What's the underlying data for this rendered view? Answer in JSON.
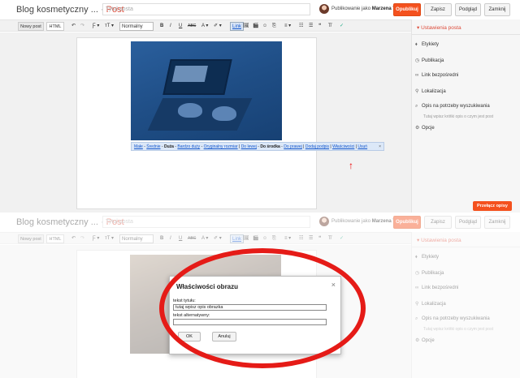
{
  "header": {
    "blog_title": "Blog kosmetyczny ...",
    "separator": "·",
    "section": "Post",
    "title_placeholder": "Tytuł posta",
    "publishing_as_prefix": "Publikowanie jako ",
    "user_name": "Marzena T",
    "publish_button": "Opublikuj",
    "save_button": "Zapisz",
    "preview_button": "Podgląd",
    "close_button": "Zamknij"
  },
  "toolbar": {
    "compose_mode": "Nowy post",
    "html_mode": "HTML",
    "undo": "↶",
    "redo": "↷",
    "font": "Ƒ ▾",
    "font_size": "ᴛT ▾",
    "format": "Normalny",
    "bold": "B",
    "italic": "I",
    "underline": "U",
    "strike": "ABC",
    "text_color": "A ▾",
    "highlight": "✐ ▾",
    "link": "Link",
    "image": "🖼",
    "video": "🎬",
    "emoji": "☺",
    "jump": "⎘",
    "align": "≡ ▾",
    "numbered": "☷",
    "bulleted": "☰",
    "quote": "❝",
    "clear": "T̸",
    "spell": "✓"
  },
  "image_size_bar": {
    "small": "Małe",
    "medium": "Średnie",
    "large": "Duża",
    "xlarge": "Bardzo duży",
    "original": "Oryginalny rozmiar",
    "left": "Do lewej",
    "center": "Do środka",
    "right": "Do prawej",
    "caption": "Dodaj podpis",
    "properties": "Właściwości",
    "remove": "Usuń",
    "close": "×"
  },
  "sidebar": {
    "heading": "▾ Ustawienia posta",
    "labels": "Etykiety",
    "publication": "Publikacja",
    "permalink": "Link bezpośredni",
    "location": "Lokalizacja",
    "search_description": "Opis na potrzeby wyszukiwania",
    "search_description_hint": "Tutaj wpisz krótki opis o czym jest post",
    "options": "Opcje",
    "translate_button": "Przełącz opisy"
  },
  "dialog": {
    "title": "Właściwości obrazu",
    "close": "×",
    "title_label": "tekst tytułu:",
    "title_value": "tutaj wpisz opis obrazka",
    "alt_label": "tekst alternatywny:",
    "alt_value": "",
    "ok": "OK",
    "cancel": "Anuluj"
  },
  "colors": {
    "accent": "#f4511e",
    "highlight_ellipse": "#e51b17",
    "arrow": "#e00000"
  }
}
